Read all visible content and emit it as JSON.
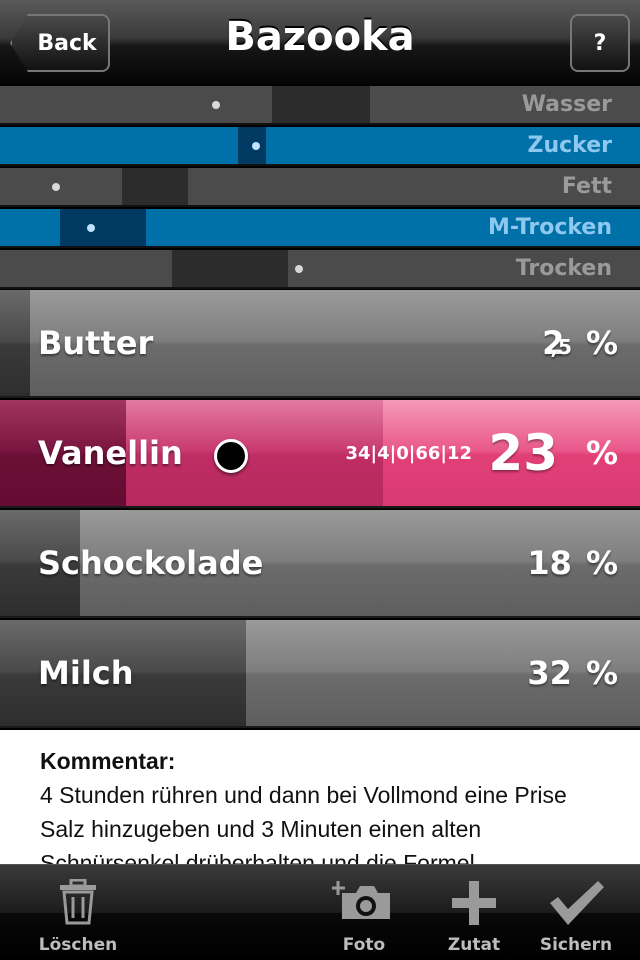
{
  "navbar": {
    "title": "Bazooka",
    "back_label": "Back",
    "help_label": "?"
  },
  "profile": [
    {
      "label": "Wasser",
      "style": "grey"
    },
    {
      "label": "Zucker",
      "style": "blue"
    },
    {
      "label": "Fett",
      "style": "grey"
    },
    {
      "label": "M-Trocken",
      "style": "blue"
    },
    {
      "label": "Trocken",
      "style": "grey"
    }
  ],
  "ingredients": [
    {
      "name": "Butter",
      "value": "2",
      "fraction": ",5",
      "unit": "%"
    },
    {
      "name": "Vanellin",
      "ratio": "34|4|0|66|12",
      "value": "23",
      "unit": "%"
    },
    {
      "name": "Schockolade",
      "value": "18",
      "unit": "%"
    },
    {
      "name": "Milch",
      "value": "32",
      "unit": "%"
    }
  ],
  "comment": {
    "heading": "Kommentar:",
    "body": "4 Stunden rühren und dann bei Vollmond eine Prise Salz hinzugeben und 3 Minuten einen alten Schnürsenkel drüberhalten und die Formel"
  },
  "tabbar": {
    "delete_label": "Löschen",
    "photo_label": "Foto",
    "add_label": "Zutat",
    "save_label": "Sichern"
  },
  "colors": {
    "accent_blue": "#0070a8",
    "accent_pink": "#e23f77"
  }
}
